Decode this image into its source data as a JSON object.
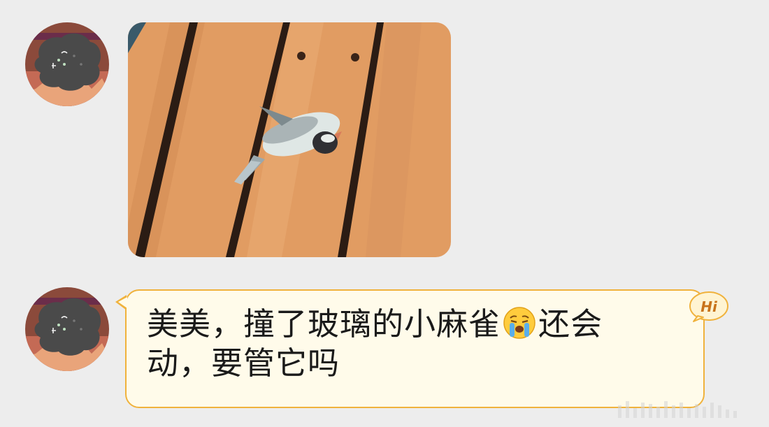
{
  "chat": {
    "messages": [
      {
        "type": "image",
        "sender": "other",
        "avatar": "black-blob-avatar",
        "image": "wooden-deck-sparrow-photo"
      },
      {
        "type": "text",
        "sender": "other",
        "avatar": "black-blob-avatar",
        "text_part1": "美美，撞了玻璃的小麻雀",
        "emoji": "crying-face-emoji",
        "text_part2": "还会动，要管它吗",
        "badge": "Hi"
      }
    ]
  },
  "colors": {
    "background": "#ededed",
    "bubble_fill": "#fffbea",
    "bubble_border": "#f0b23c",
    "badge_text": "#c8731a",
    "text": "#1a1a1a"
  }
}
